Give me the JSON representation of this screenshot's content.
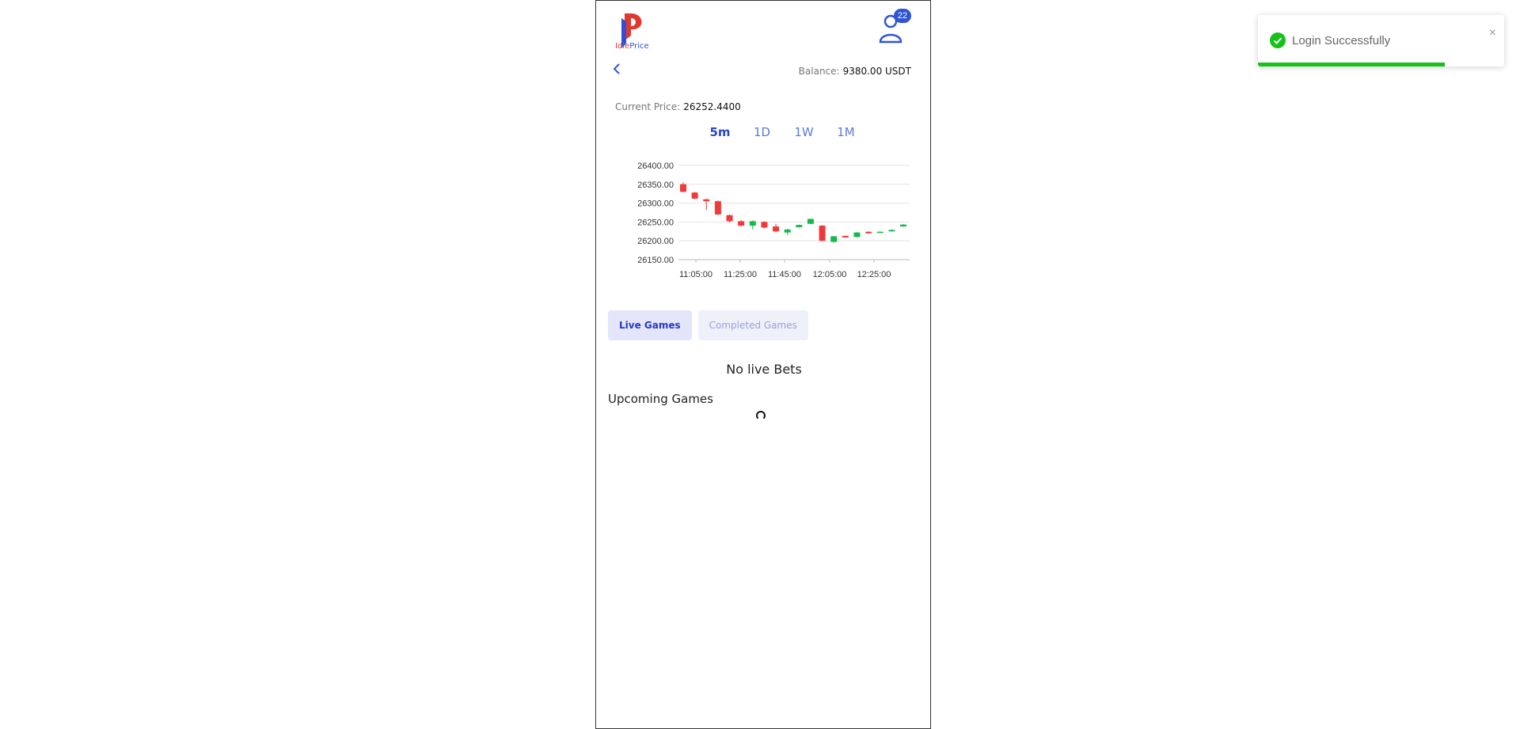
{
  "brand": {
    "logo_text_1": "Idle",
    "logo_text_2": "Price"
  },
  "user": {
    "notification_count": "22"
  },
  "balance": {
    "label": "Balance:",
    "value": "9380.00 USDT"
  },
  "current_price": {
    "label": "Current Price:",
    "value": "26252.4400"
  },
  "timeframes": [
    {
      "label": "5m",
      "active": true
    },
    {
      "label": "1D",
      "active": false
    },
    {
      "label": "1W",
      "active": false
    },
    {
      "label": "1M",
      "active": false
    }
  ],
  "game_tabs": [
    {
      "label": "Live Games",
      "active": true
    },
    {
      "label": "Completed Games",
      "active": false
    }
  ],
  "no_live_text": "No live Bets",
  "upcoming_title": "Upcoming Games",
  "toast": {
    "message": "Login Successfully",
    "close": "×",
    "progress": 0.76
  },
  "colors": {
    "up": "#16b94d",
    "down": "#ee3a3a",
    "accent": "#2f55d4"
  },
  "chart_data": {
    "type": "candlestick",
    "y_ticks": [
      "26400.00",
      "26350.00",
      "26300.00",
      "26250.00",
      "26200.00",
      "26150.00"
    ],
    "x_ticks": [
      "11:05:00",
      "11:25:00",
      "11:45:00",
      "12:05:00",
      "12:25:00"
    ],
    "ylim": [
      26150,
      26400
    ],
    "grid": true,
    "candles": [
      {
        "o": 26350,
        "c": 26330,
        "h": 26355,
        "l": 26328
      },
      {
        "o": 26328,
        "c": 26312,
        "h": 26330,
        "l": 26310
      },
      {
        "o": 26310,
        "c": 26305,
        "h": 26312,
        "l": 26282
      },
      {
        "o": 26305,
        "c": 26270,
        "h": 26307,
        "l": 26268
      },
      {
        "o": 26268,
        "c": 26252,
        "h": 26270,
        "l": 26248
      },
      {
        "o": 26252,
        "c": 26240,
        "h": 26255,
        "l": 26238
      },
      {
        "o": 26240,
        "c": 26252,
        "h": 26254,
        "l": 26230
      },
      {
        "o": 26250,
        "c": 26235,
        "h": 26252,
        "l": 26233
      },
      {
        "o": 26238,
        "c": 26225,
        "h": 26245,
        "l": 26222
      },
      {
        "o": 26222,
        "c": 26230,
        "h": 26232,
        "l": 26215
      },
      {
        "o": 26236,
        "c": 26242,
        "h": 26243,
        "l": 26235
      },
      {
        "o": 26245,
        "c": 26258,
        "h": 26259,
        "l": 26244
      },
      {
        "o": 26240,
        "c": 26200,
        "h": 26242,
        "l": 26198
      },
      {
        "o": 26197,
        "c": 26212,
        "h": 26213,
        "l": 26195
      },
      {
        "o": 26213,
        "c": 26209,
        "h": 26214,
        "l": 26208
      },
      {
        "o": 26210,
        "c": 26222,
        "h": 26223,
        "l": 26209
      },
      {
        "o": 26224,
        "c": 26220,
        "h": 26225,
        "l": 26219
      },
      {
        "o": 26222,
        "c": 26224,
        "h": 26225,
        "l": 26221
      },
      {
        "o": 26225,
        "c": 26229,
        "h": 26230,
        "l": 26224
      },
      {
        "o": 26238,
        "c": 26243,
        "h": 26244,
        "l": 26237
      }
    ]
  }
}
